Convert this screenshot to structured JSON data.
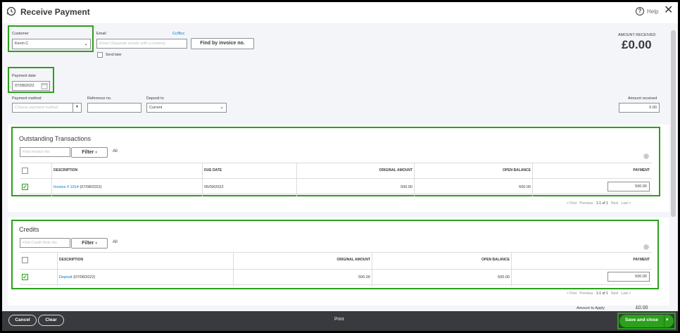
{
  "header": {
    "title": "Receive Payment",
    "help_label": "Help"
  },
  "customer": {
    "label": "Customer",
    "value": "Kevin C"
  },
  "email": {
    "label": "Email",
    "placeholder": "Email (Separate emails with a comma)",
    "ccbcc": "Cc/Bcc",
    "send_later": "Send later"
  },
  "find_button": "Find by invoice no.",
  "amount_received_summary": {
    "label": "AMOUNT RECEIVED",
    "value": "£0.00"
  },
  "payment_date": {
    "label": "Payment date",
    "value": "07/08/2022"
  },
  "payment_method": {
    "label": "Payment method",
    "placeholder": "Choose payment method"
  },
  "reference": {
    "label": "Reference no.",
    "value": ""
  },
  "deposit_to": {
    "label": "Deposit to",
    "value": "Current"
  },
  "amount_received": {
    "label": "Amount received",
    "value": "0.00"
  },
  "outstanding": {
    "title": "Outstanding Transactions",
    "search_placeholder": "Find Invoice No.",
    "filter_label": "Filter",
    "all_label": "All",
    "columns": {
      "description": "DESCRIPTION",
      "due_date": "DUE DATE",
      "original_amount": "ORIGINAL AMOUNT",
      "open_balance": "OPEN BALANCE",
      "payment": "PAYMENT"
    },
    "rows": [
      {
        "link": "Invoice # 1014",
        "date": "(07/08/2022)",
        "due_date": "06/09/2022",
        "original_amount": "500.00",
        "open_balance": "500.00",
        "payment": "500.00",
        "checked": true
      }
    ],
    "pager": {
      "first": "< First",
      "previous": "Previous",
      "range": "1-1 of 1",
      "next": "Next",
      "last": "Last >"
    }
  },
  "credits": {
    "title": "Credits",
    "search_placeholder": "Find Credit Note No.",
    "filter_label": "Filter",
    "all_label": "All",
    "columns": {
      "description": "DESCRIPTION",
      "original_amount": "ORIGINAL AMOUNT",
      "open_balance": "OPEN BALANCE",
      "payment": "PAYMENT"
    },
    "rows": [
      {
        "link": "Deposit",
        "date": "(07/08/2022)",
        "original_amount": "500.00",
        "open_balance": "500.00",
        "payment": "500.00",
        "checked": true
      }
    ],
    "pager": {
      "first": "< First",
      "previous": "Previous",
      "range": "1-1 of 1",
      "next": "Next",
      "last": "Last >"
    }
  },
  "amount_to_apply": {
    "label": "Amount to Apply",
    "value": "£0.00"
  },
  "footer": {
    "cancel": "Cancel",
    "clear": "Clear",
    "print": "Print",
    "save_close": "Save and close"
  },
  "colors": {
    "accent_green": "#2ca01c",
    "link_blue": "#0077c5",
    "footer_dark": "#393a3d"
  }
}
